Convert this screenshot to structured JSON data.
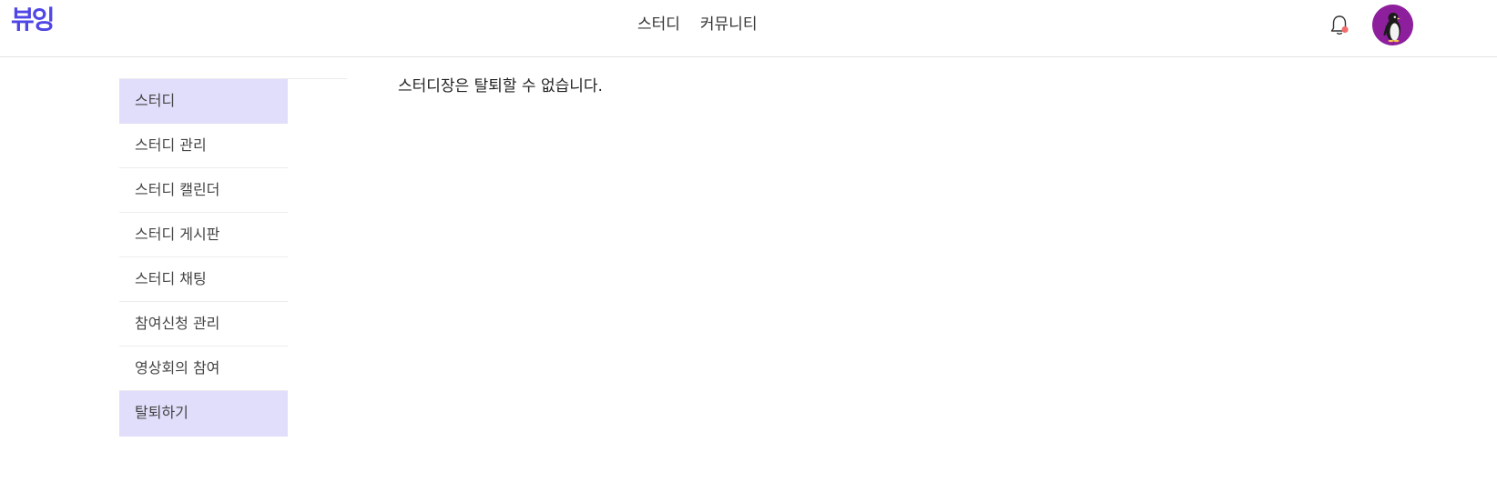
{
  "header": {
    "logo": "뷰잉",
    "nav": [
      {
        "label": "스터디"
      },
      {
        "label": "커뮤니티"
      }
    ],
    "bell_icon": "bell-icon",
    "notification_dot_color": "#f26b6b",
    "avatar_icon": "penguin-avatar",
    "avatar_bg": "#8d1e9c",
    "accent_color": "#4f46e5"
  },
  "sidebar": {
    "items": [
      {
        "label": "스터디",
        "active": true
      },
      {
        "label": "스터디 관리",
        "active": false
      },
      {
        "label": "스터디 캘린더",
        "active": false
      },
      {
        "label": "스터디 게시판",
        "active": false
      },
      {
        "label": "스터디 채팅",
        "active": false
      },
      {
        "label": "참여신청 관리",
        "active": false
      },
      {
        "label": "영상회의 참여",
        "active": false
      },
      {
        "label": "탈퇴하기",
        "active": true
      }
    ],
    "active_bg": "#e0defa"
  },
  "main": {
    "message": "스터디장은 탈퇴할 수 없습니다."
  }
}
